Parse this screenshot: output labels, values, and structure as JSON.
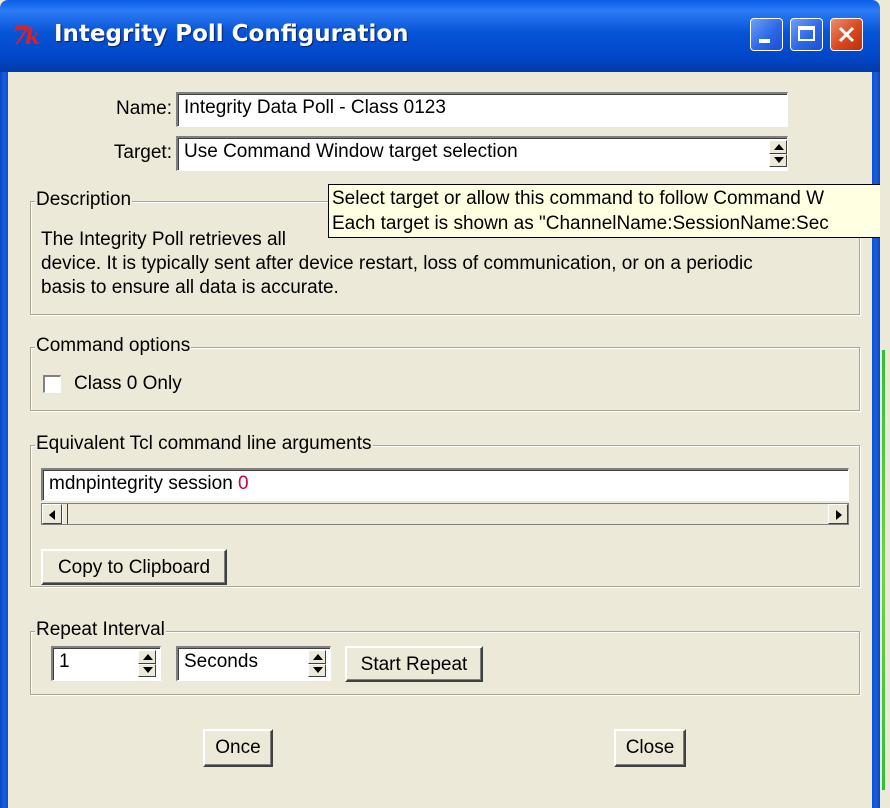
{
  "window": {
    "title": "Integrity Poll Configuration",
    "icon": "tk-feather-icon",
    "buttons": [
      "minimize-icon",
      "maximize-icon",
      "close-icon"
    ]
  },
  "form": {
    "name_label": "Name:",
    "name_value": "Integrity Data Poll - Class 0123",
    "target_label": "Target:",
    "target_value": "Use Command Window target selection"
  },
  "description": {
    "title": "Description",
    "line1": "The Integrity Poll retrieves all",
    "line2": "device. It is typically sent after device restart, loss of communication, or on a periodic",
    "line3": "basis to ensure all data is accurate."
  },
  "tooltip": {
    "line1": "Select target or allow this command to follow Command W",
    "line2": "Each target is shown as \"ChannelName:SessionName:Sec"
  },
  "command_options": {
    "title": "Command options",
    "class0_label": "Class 0 Only",
    "class0_checked": false
  },
  "tcl": {
    "title": "Equivalent Tcl command line arguments",
    "command_text": "mdnpintegrity session ",
    "command_arg": "0",
    "copy_button": "Copy to Clipboard"
  },
  "repeat": {
    "title": "Repeat Interval",
    "interval_value": "1",
    "unit_value": "Seconds",
    "start_button": "Start Repeat"
  },
  "actions": {
    "once_button": "Once",
    "close_button": "Close"
  },
  "colors": {
    "titlebar": "#0754D6",
    "dialog_bg": "#ECE9D8",
    "tooltip_bg": "#FFFFE1",
    "tcl_arg": "#CC0044"
  }
}
